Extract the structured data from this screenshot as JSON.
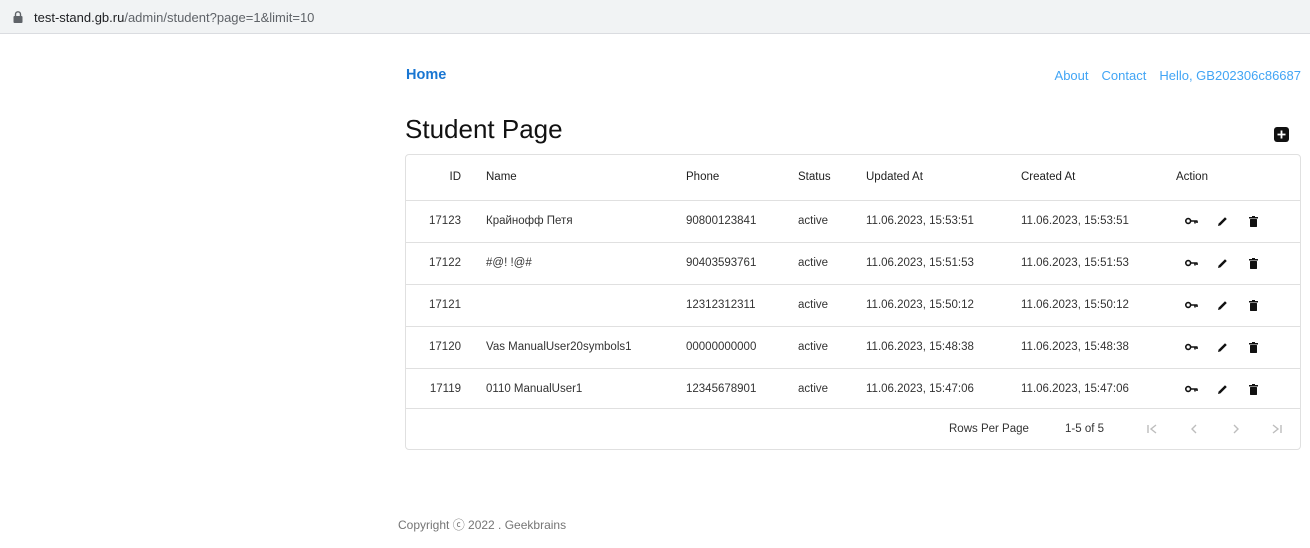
{
  "browser": {
    "url_host": "test-stand.gb.ru",
    "url_path": "/admin/student?page=1&limit=10"
  },
  "nav": {
    "home": "Home",
    "about": "About",
    "contact": "Contact",
    "greeting": "Hello, GB202306c86687"
  },
  "page": {
    "title": "Student Page"
  },
  "table": {
    "headers": {
      "id": "ID",
      "name": "Name",
      "phone": "Phone",
      "status": "Status",
      "updated": "Updated At",
      "created": "Created At",
      "action": "Action"
    },
    "rows": [
      {
        "id": "17123",
        "name": "Крайнофф Петя",
        "phone": "90800123841",
        "status": "active",
        "updated": "11.06.2023, 15:53:51",
        "created": "11.06.2023, 15:53:51"
      },
      {
        "id": "17122",
        "name": "#@! !@#",
        "phone": "90403593761",
        "status": "active",
        "updated": "11.06.2023, 15:51:53",
        "created": "11.06.2023, 15:51:53"
      },
      {
        "id": "17121",
        "name": "",
        "phone": "12312312311",
        "status": "active",
        "updated": "11.06.2023, 15:50:12",
        "created": "11.06.2023, 15:50:12"
      },
      {
        "id": "17120",
        "name": "Vas ManualUser20symbols1",
        "phone": "00000000000",
        "status": "active",
        "updated": "11.06.2023, 15:48:38",
        "created": "11.06.2023, 15:48:38"
      },
      {
        "id": "17119",
        "name": "0110 ManualUser1",
        "phone": "12345678901",
        "status": "active",
        "updated": "11.06.2023, 15:47:06",
        "created": "11.06.2023, 15:47:06"
      }
    ]
  },
  "pagination": {
    "rows_per_page_label": "Rows Per Page",
    "range": "1-5 of 5"
  },
  "footer": {
    "copyright": "Copyright ⓒ 2022 . Geekbrains"
  },
  "colors": {
    "link_primary": "#1976d2",
    "link_secondary": "#42a5f5"
  }
}
